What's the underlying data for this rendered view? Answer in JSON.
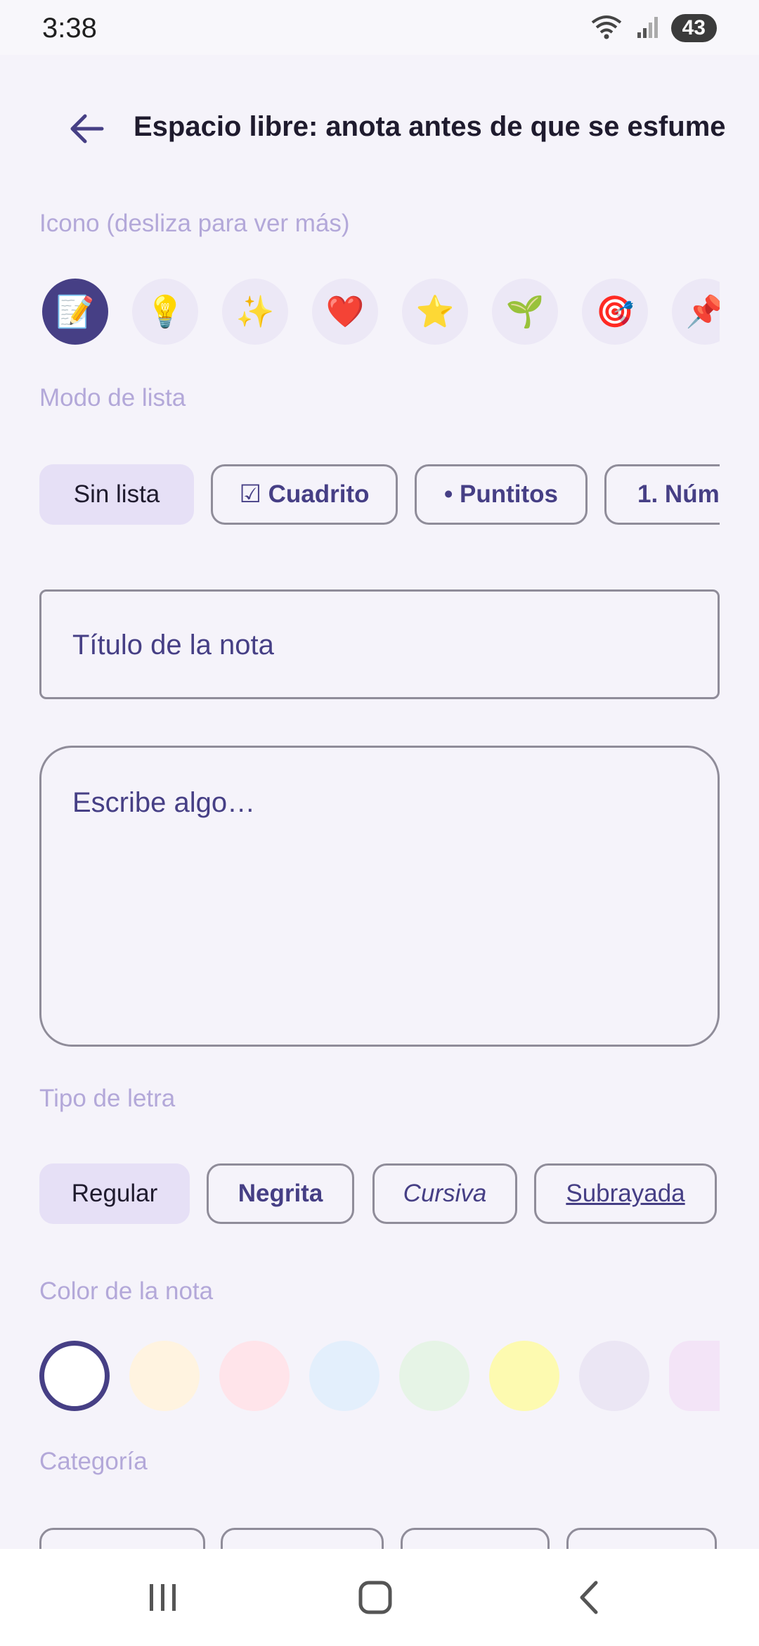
{
  "status_bar": {
    "time": "3:38",
    "battery": "43",
    "wifi_badge": "5"
  },
  "header": {
    "title": "Espacio libre: anota antes de que se esfume"
  },
  "icon_section": {
    "label": "Icono (desliza para ver más)",
    "icons": [
      {
        "name": "memo-icon",
        "glyph": "📝",
        "selected": true
      },
      {
        "name": "lightbulb-icon",
        "glyph": "💡"
      },
      {
        "name": "sparkles-icon",
        "glyph": "✨"
      },
      {
        "name": "heart-icon",
        "glyph": "❤️"
      },
      {
        "name": "star-icon",
        "glyph": "⭐"
      },
      {
        "name": "seedling-icon",
        "glyph": "🌱"
      },
      {
        "name": "target-icon",
        "glyph": "🎯"
      },
      {
        "name": "pushpin-icon",
        "glyph": "📌"
      }
    ]
  },
  "list_mode": {
    "label": "Modo de lista",
    "options": [
      "Sin lista",
      "☑ Cuadrito",
      "• Puntitos",
      "1. Núm"
    ],
    "selected": "Sin lista"
  },
  "inputs": {
    "title_placeholder": "Título de la nota",
    "body_placeholder": "Escribe algo…"
  },
  "font_type": {
    "label": "Tipo de letra",
    "options": [
      "Regular",
      "Negrita",
      "Cursiva",
      "Subrayada"
    ],
    "selected": "Regular"
  },
  "note_color": {
    "label": "Color de la nota",
    "colors": [
      "#ffffff",
      "#fff3e0",
      "#ffe4ea",
      "#e3effc",
      "#e6f4e6",
      "#fdfab0",
      "#ebe6f4",
      "#f3e4f7"
    ],
    "selected": "#ffffff"
  },
  "category": {
    "label": "Categoría"
  },
  "colors": {
    "accent": "#463f85",
    "label": "#b3a8d9",
    "selected_chip": "#e6e0f6"
  }
}
